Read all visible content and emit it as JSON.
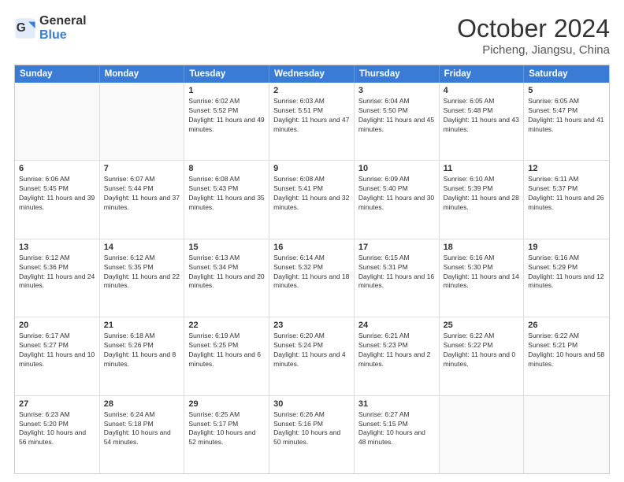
{
  "header": {
    "logo_general": "General",
    "logo_blue": "Blue",
    "month_title": "October 2024",
    "location": "Picheng, Jiangsu, China"
  },
  "days_of_week": [
    "Sunday",
    "Monday",
    "Tuesday",
    "Wednesday",
    "Thursday",
    "Friday",
    "Saturday"
  ],
  "weeks": [
    [
      {
        "day": "",
        "sunrise": "",
        "sunset": "",
        "daylight": "",
        "empty": true
      },
      {
        "day": "",
        "sunrise": "",
        "sunset": "",
        "daylight": "",
        "empty": true
      },
      {
        "day": "1",
        "sunrise": "Sunrise: 6:02 AM",
        "sunset": "Sunset: 5:52 PM",
        "daylight": "Daylight: 11 hours and 49 minutes.",
        "empty": false
      },
      {
        "day": "2",
        "sunrise": "Sunrise: 6:03 AM",
        "sunset": "Sunset: 5:51 PM",
        "daylight": "Daylight: 11 hours and 47 minutes.",
        "empty": false
      },
      {
        "day": "3",
        "sunrise": "Sunrise: 6:04 AM",
        "sunset": "Sunset: 5:50 PM",
        "daylight": "Daylight: 11 hours and 45 minutes.",
        "empty": false
      },
      {
        "day": "4",
        "sunrise": "Sunrise: 6:05 AM",
        "sunset": "Sunset: 5:48 PM",
        "daylight": "Daylight: 11 hours and 43 minutes.",
        "empty": false
      },
      {
        "day": "5",
        "sunrise": "Sunrise: 6:05 AM",
        "sunset": "Sunset: 5:47 PM",
        "daylight": "Daylight: 11 hours and 41 minutes.",
        "empty": false
      }
    ],
    [
      {
        "day": "6",
        "sunrise": "Sunrise: 6:06 AM",
        "sunset": "Sunset: 5:45 PM",
        "daylight": "Daylight: 11 hours and 39 minutes.",
        "empty": false
      },
      {
        "day": "7",
        "sunrise": "Sunrise: 6:07 AM",
        "sunset": "Sunset: 5:44 PM",
        "daylight": "Daylight: 11 hours and 37 minutes.",
        "empty": false
      },
      {
        "day": "8",
        "sunrise": "Sunrise: 6:08 AM",
        "sunset": "Sunset: 5:43 PM",
        "daylight": "Daylight: 11 hours and 35 minutes.",
        "empty": false
      },
      {
        "day": "9",
        "sunrise": "Sunrise: 6:08 AM",
        "sunset": "Sunset: 5:41 PM",
        "daylight": "Daylight: 11 hours and 32 minutes.",
        "empty": false
      },
      {
        "day": "10",
        "sunrise": "Sunrise: 6:09 AM",
        "sunset": "Sunset: 5:40 PM",
        "daylight": "Daylight: 11 hours and 30 minutes.",
        "empty": false
      },
      {
        "day": "11",
        "sunrise": "Sunrise: 6:10 AM",
        "sunset": "Sunset: 5:39 PM",
        "daylight": "Daylight: 11 hours and 28 minutes.",
        "empty": false
      },
      {
        "day": "12",
        "sunrise": "Sunrise: 6:11 AM",
        "sunset": "Sunset: 5:37 PM",
        "daylight": "Daylight: 11 hours and 26 minutes.",
        "empty": false
      }
    ],
    [
      {
        "day": "13",
        "sunrise": "Sunrise: 6:12 AM",
        "sunset": "Sunset: 5:36 PM",
        "daylight": "Daylight: 11 hours and 24 minutes.",
        "empty": false
      },
      {
        "day": "14",
        "sunrise": "Sunrise: 6:12 AM",
        "sunset": "Sunset: 5:35 PM",
        "daylight": "Daylight: 11 hours and 22 minutes.",
        "empty": false
      },
      {
        "day": "15",
        "sunrise": "Sunrise: 6:13 AM",
        "sunset": "Sunset: 5:34 PM",
        "daylight": "Daylight: 11 hours and 20 minutes.",
        "empty": false
      },
      {
        "day": "16",
        "sunrise": "Sunrise: 6:14 AM",
        "sunset": "Sunset: 5:32 PM",
        "daylight": "Daylight: 11 hours and 18 minutes.",
        "empty": false
      },
      {
        "day": "17",
        "sunrise": "Sunrise: 6:15 AM",
        "sunset": "Sunset: 5:31 PM",
        "daylight": "Daylight: 11 hours and 16 minutes.",
        "empty": false
      },
      {
        "day": "18",
        "sunrise": "Sunrise: 6:16 AM",
        "sunset": "Sunset: 5:30 PM",
        "daylight": "Daylight: 11 hours and 14 minutes.",
        "empty": false
      },
      {
        "day": "19",
        "sunrise": "Sunrise: 6:16 AM",
        "sunset": "Sunset: 5:29 PM",
        "daylight": "Daylight: 11 hours and 12 minutes.",
        "empty": false
      }
    ],
    [
      {
        "day": "20",
        "sunrise": "Sunrise: 6:17 AM",
        "sunset": "Sunset: 5:27 PM",
        "daylight": "Daylight: 11 hours and 10 minutes.",
        "empty": false
      },
      {
        "day": "21",
        "sunrise": "Sunrise: 6:18 AM",
        "sunset": "Sunset: 5:26 PM",
        "daylight": "Daylight: 11 hours and 8 minutes.",
        "empty": false
      },
      {
        "day": "22",
        "sunrise": "Sunrise: 6:19 AM",
        "sunset": "Sunset: 5:25 PM",
        "daylight": "Daylight: 11 hours and 6 minutes.",
        "empty": false
      },
      {
        "day": "23",
        "sunrise": "Sunrise: 6:20 AM",
        "sunset": "Sunset: 5:24 PM",
        "daylight": "Daylight: 11 hours and 4 minutes.",
        "empty": false
      },
      {
        "day": "24",
        "sunrise": "Sunrise: 6:21 AM",
        "sunset": "Sunset: 5:23 PM",
        "daylight": "Daylight: 11 hours and 2 minutes.",
        "empty": false
      },
      {
        "day": "25",
        "sunrise": "Sunrise: 6:22 AM",
        "sunset": "Sunset: 5:22 PM",
        "daylight": "Daylight: 11 hours and 0 minutes.",
        "empty": false
      },
      {
        "day": "26",
        "sunrise": "Sunrise: 6:22 AM",
        "sunset": "Sunset: 5:21 PM",
        "daylight": "Daylight: 10 hours and 58 minutes.",
        "empty": false
      }
    ],
    [
      {
        "day": "27",
        "sunrise": "Sunrise: 6:23 AM",
        "sunset": "Sunset: 5:20 PM",
        "daylight": "Daylight: 10 hours and 56 minutes.",
        "empty": false
      },
      {
        "day": "28",
        "sunrise": "Sunrise: 6:24 AM",
        "sunset": "Sunset: 5:18 PM",
        "daylight": "Daylight: 10 hours and 54 minutes.",
        "empty": false
      },
      {
        "day": "29",
        "sunrise": "Sunrise: 6:25 AM",
        "sunset": "Sunset: 5:17 PM",
        "daylight": "Daylight: 10 hours and 52 minutes.",
        "empty": false
      },
      {
        "day": "30",
        "sunrise": "Sunrise: 6:26 AM",
        "sunset": "Sunset: 5:16 PM",
        "daylight": "Daylight: 10 hours and 50 minutes.",
        "empty": false
      },
      {
        "day": "31",
        "sunrise": "Sunrise: 6:27 AM",
        "sunset": "Sunset: 5:15 PM",
        "daylight": "Daylight: 10 hours and 48 minutes.",
        "empty": false
      },
      {
        "day": "",
        "sunrise": "",
        "sunset": "",
        "daylight": "",
        "empty": true
      },
      {
        "day": "",
        "sunrise": "",
        "sunset": "",
        "daylight": "",
        "empty": true
      }
    ]
  ]
}
